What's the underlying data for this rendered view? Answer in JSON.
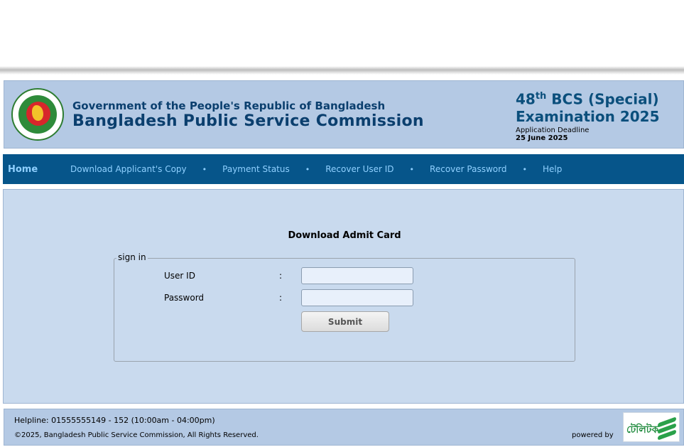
{
  "header": {
    "gov_title": "Government of the People's Republic of Bangladesh",
    "org_title": "Bangladesh Public Service Commission",
    "exam_number": "48",
    "exam_suffix": "th",
    "exam_line1_rest": " BCS (Special)",
    "exam_line2": "Examination 2025",
    "deadline_label": "Application Deadline",
    "deadline_date": "25 June 2025"
  },
  "nav": {
    "home": "Home",
    "items": [
      {
        "label": "Download Applicant's Copy"
      },
      {
        "label": "Payment Status"
      },
      {
        "label": "Recover User ID"
      },
      {
        "label": "Recover Password"
      },
      {
        "label": "Help"
      }
    ],
    "separator": "•"
  },
  "form": {
    "title": "Download Admit Card",
    "legend": "sign in",
    "user_id_label": "User ID",
    "password_label": "Password",
    "colon": ":",
    "user_id_value": "",
    "password_value": "",
    "submit_label": "Submit"
  },
  "footer": {
    "helpline": "Helpline: 01555555149 - 152 (10:00am - 04:00pm)",
    "copyright": "©2025, Bangladesh Public Service Commission, All Rights Reserved.",
    "powered_by": "powered by",
    "partner_logo": "টেলিটক"
  },
  "colors": {
    "header_bg": "#b4c9e4",
    "nav_bg": "#06558a",
    "nav_text": "#8fd0ff",
    "content_bg": "#c9daee",
    "title_text": "#0b3f6e"
  },
  "icons": {
    "logo": "bangladesh-government-seal",
    "partner": "teletalk-logo"
  }
}
